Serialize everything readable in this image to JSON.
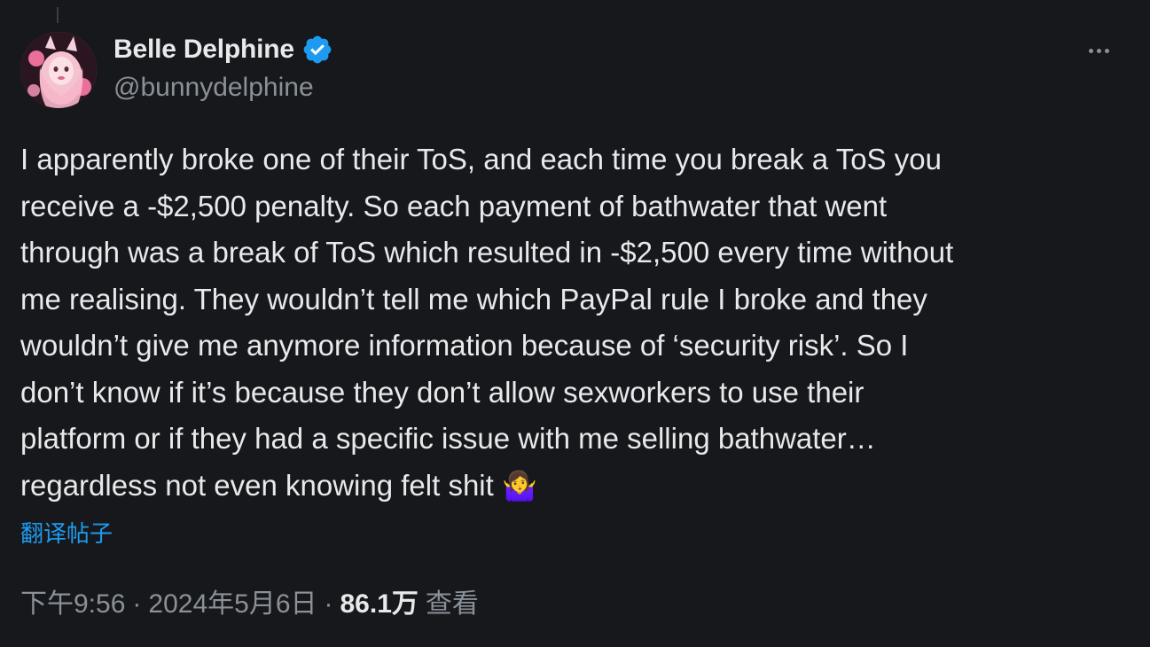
{
  "author": {
    "display_name": "Belle Delphine",
    "handle": "@bunnydelphine",
    "verified": true,
    "verified_color": "#1d9bf0"
  },
  "tweet": {
    "text_lines": [
      "I apparently broke one of their ToS, and each time you break a ToS you",
      "receive a -$2,500 penalty. So each payment of bathwater that went",
      "through was a break of ToS which resulted in -$2,500 every time without",
      "me realising. They wouldn’t tell me which PayPal rule I broke and they",
      "wouldn’t give me anymore information because of ‘security risk’. So I",
      "don’t know if it’s because they don’t allow sexworkers to use their",
      "platform or if they had a specific issue with me selling bathwater…",
      "regardless not even knowing felt shit"
    ],
    "emoji": "🤷‍♀️",
    "translate_label": "翻译帖子"
  },
  "meta": {
    "time": "下午9:56",
    "separator": "·",
    "date": "2024年5月6日",
    "views_count": "86.1万",
    "views_label": "查看"
  },
  "icons": {
    "more": "more-horizontal-icon",
    "verified": "verified-badge-icon",
    "avatar": "avatar-image"
  }
}
